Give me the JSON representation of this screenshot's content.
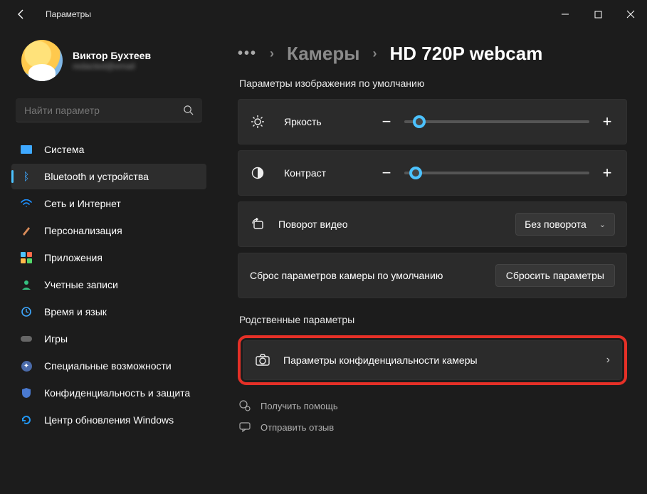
{
  "titlebar": {
    "title": "Параметры"
  },
  "user": {
    "name": "Виктор Бухтеев",
    "email": "redacted@email"
  },
  "search": {
    "placeholder": "Найти параметр"
  },
  "nav": [
    {
      "label": "Система"
    },
    {
      "label": "Bluetooth и устройства"
    },
    {
      "label": "Сеть и Интернет"
    },
    {
      "label": "Персонализация"
    },
    {
      "label": "Приложения"
    },
    {
      "label": "Учетные записи"
    },
    {
      "label": "Время и язык"
    },
    {
      "label": "Игры"
    },
    {
      "label": "Специальные возможности"
    },
    {
      "label": "Конфиденциальность и защита"
    },
    {
      "label": "Центр обновления Windows"
    }
  ],
  "breadcrumb": {
    "parent": "Камеры",
    "current": "HD 720P webcam"
  },
  "sections": {
    "defaults": "Параметры изображения по умолчанию",
    "related": "Родственные параметры"
  },
  "sliders": {
    "brightness": {
      "label": "Яркость",
      "value": 8
    },
    "contrast": {
      "label": "Контраст",
      "value": 6
    }
  },
  "rotation": {
    "label": "Поворот видео",
    "value": "Без поворота"
  },
  "reset": {
    "label": "Сброс параметров камеры по умолчанию",
    "button": "Сбросить параметры"
  },
  "privacy": {
    "label": "Параметры конфиденциальности камеры"
  },
  "help": {
    "get": "Получить помощь",
    "feedback": "Отправить отзыв"
  }
}
